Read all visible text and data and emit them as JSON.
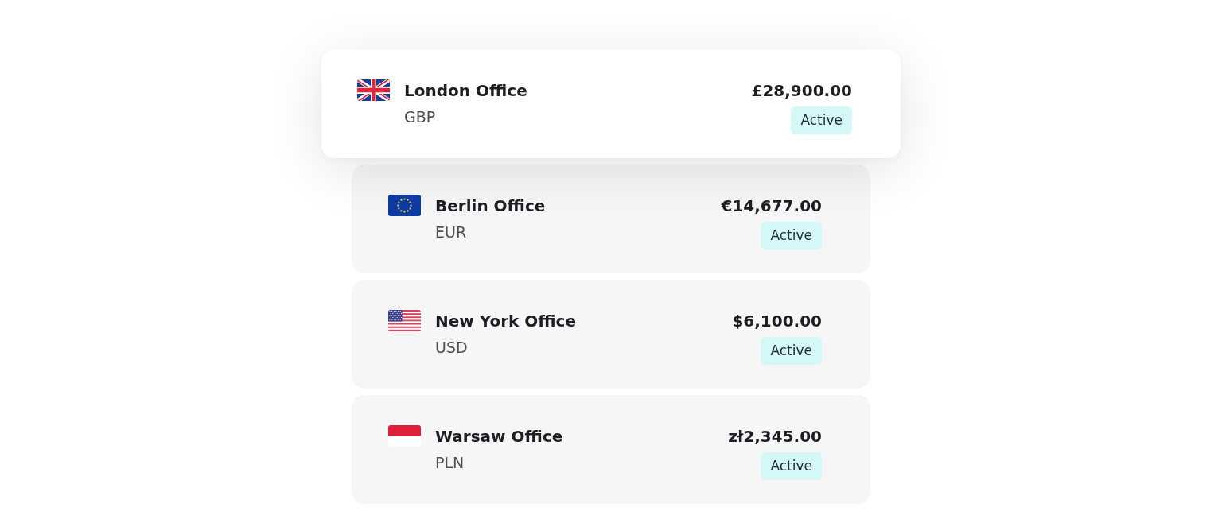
{
  "offices": [
    {
      "kind": "gb",
      "name": "London Office",
      "currency": "GBP",
      "amount": "£28,900.00",
      "status": "Active",
      "selected": true
    },
    {
      "kind": "eu",
      "name": "Berlin Office",
      "currency": "EUR",
      "amount": "€14,677.00",
      "status": "Active",
      "selected": false
    },
    {
      "kind": "us",
      "name": "New York Office",
      "currency": "USD",
      "amount": "$6,100.00",
      "status": "Active",
      "selected": false
    },
    {
      "kind": "pl",
      "name": "Warsaw Office",
      "currency": "PLN",
      "amount": "zł2,345.00",
      "status": "Active",
      "selected": false
    }
  ]
}
